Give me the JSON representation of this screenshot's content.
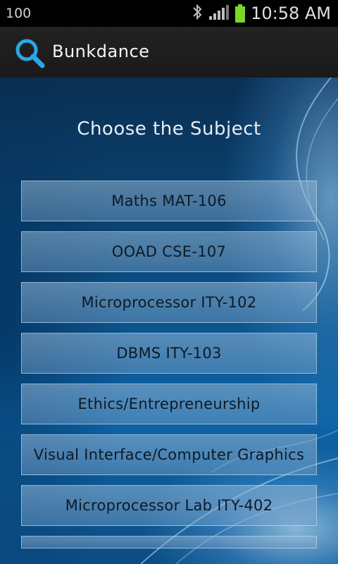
{
  "status_bar": {
    "left_text": "100",
    "time": "10:58 AM",
    "icons": [
      "bluetooth-icon",
      "signal-icon",
      "battery-icon"
    ],
    "battery_color": "#7cd62a"
  },
  "action_bar": {
    "app_title": "Bunkdance",
    "icon": "search-icon",
    "accent": "#2aa7e6"
  },
  "main": {
    "title": "Choose the Subject",
    "subjects": [
      {
        "label": "Maths MAT-106"
      },
      {
        "label": "OOAD CSE-107"
      },
      {
        "label": "Microprocessor ITY-102"
      },
      {
        "label": "DBMS ITY-103"
      },
      {
        "label": "Ethics/Entrepreneurship"
      },
      {
        "label": "Visual Interface/Computer Graphics"
      },
      {
        "label": "Microprocessor Lab ITY-402"
      },
      {
        "label": ""
      }
    ]
  }
}
